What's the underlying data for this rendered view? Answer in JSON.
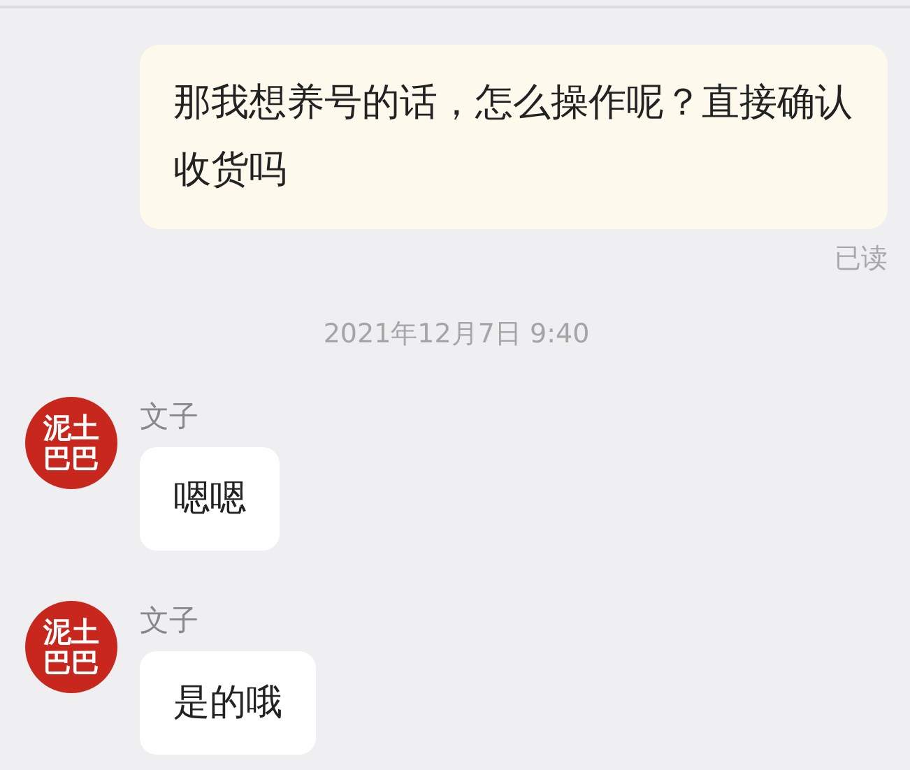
{
  "messages": [
    {
      "kind": "outgoing",
      "text": "那我想养号的话，怎么操作呢？直接确认收货吗",
      "read_receipt": "已读"
    },
    {
      "kind": "timestamp",
      "text": "2021年12月7日 9:40"
    },
    {
      "kind": "incoming",
      "sender": "文子",
      "avatar_lines": [
        "泥土",
        "巴巴"
      ],
      "text": "嗯嗯"
    },
    {
      "kind": "incoming",
      "sender": "文子",
      "avatar_lines": [
        "泥土",
        "巴巴"
      ],
      "text": "是的哦"
    }
  ]
}
